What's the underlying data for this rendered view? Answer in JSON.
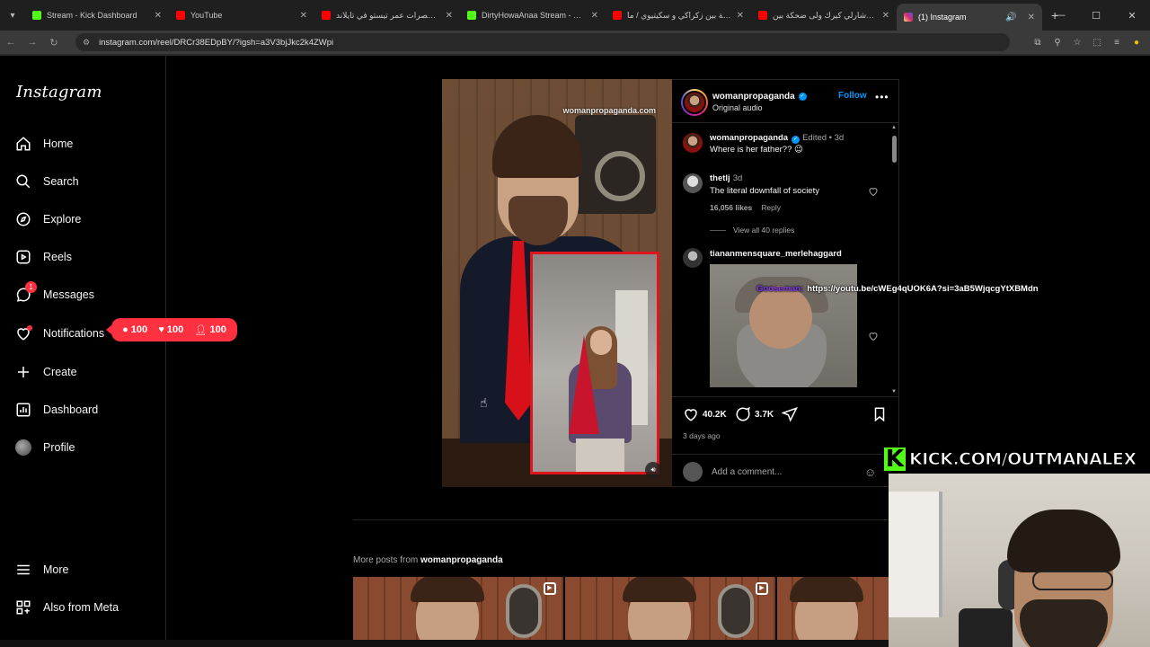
{
  "browser": {
    "tabs": [
      {
        "title": "Stream - Kick Dashboard",
        "color": "#53fc18"
      },
      {
        "title": "YouTube",
        "color": "#ff0000"
      },
      {
        "title": "قهوية خصرات عمر تيستو في تايلاند",
        "color": "#ff0000"
      },
      {
        "title": "DirtyHowaAnaa Stream - Watch",
        "color": "#53fc18"
      },
      {
        "title": "مقابلة بين زكراكي و سكيتيوي / ما",
        "color": "#ff0000"
      },
      {
        "title": "علاش شارلي كيرك ولى ضحكة بين",
        "color": "#ff0000"
      },
      {
        "title": "(1) Instagram",
        "color": "#d62976"
      }
    ],
    "url": "instagram.com/reel/DRCr38EDpBY/?igsh=a3V3bjJkc2k4ZWpi"
  },
  "sidebar": {
    "logo": "Instagram",
    "items": [
      {
        "label": "Home"
      },
      {
        "label": "Search"
      },
      {
        "label": "Explore"
      },
      {
        "label": "Reels"
      },
      {
        "label": "Messages",
        "badge": "1"
      },
      {
        "label": "Notifications"
      },
      {
        "label": "Create"
      },
      {
        "label": "Dashboard"
      },
      {
        "label": "Profile"
      },
      {
        "label": "More"
      },
      {
        "label": "Also from Meta"
      }
    ],
    "notif_pill": {
      "comments": "100",
      "likes": "100",
      "follows": "100"
    }
  },
  "reel": {
    "watermark": "womanpropaganda.com"
  },
  "panel": {
    "author": "womanpropaganda",
    "audio": "Original audio",
    "follow": "Follow",
    "caption": {
      "user": "womanpropaganda",
      "meta": "Edited • 3d",
      "text": "Where is her father?? 😉"
    },
    "comment1": {
      "user": "thetlj",
      "meta": "3d",
      "text": "The literal downfall of society",
      "likes": "16,056 likes",
      "reply": "Reply",
      "view_replies": "View all 40 replies"
    },
    "comment2": {
      "user": "tiananmensquare_merlehaggard"
    },
    "likes_count": "40.2K",
    "comments_count": "3.7K",
    "time_ago": "3 days ago",
    "add_comment_placeholder": "Add a comment..."
  },
  "overlay": {
    "link_label": "Gooseman:",
    "link": "https://youtu.be/cWEg4qUOK6A?si=3aB5WjqcgYtXBMdn",
    "kick_letter": "K",
    "kick_text": "KICK.COM/OUTMANALEX"
  },
  "more_posts": {
    "prefix": "More posts from ",
    "user": "womanpropaganda"
  }
}
